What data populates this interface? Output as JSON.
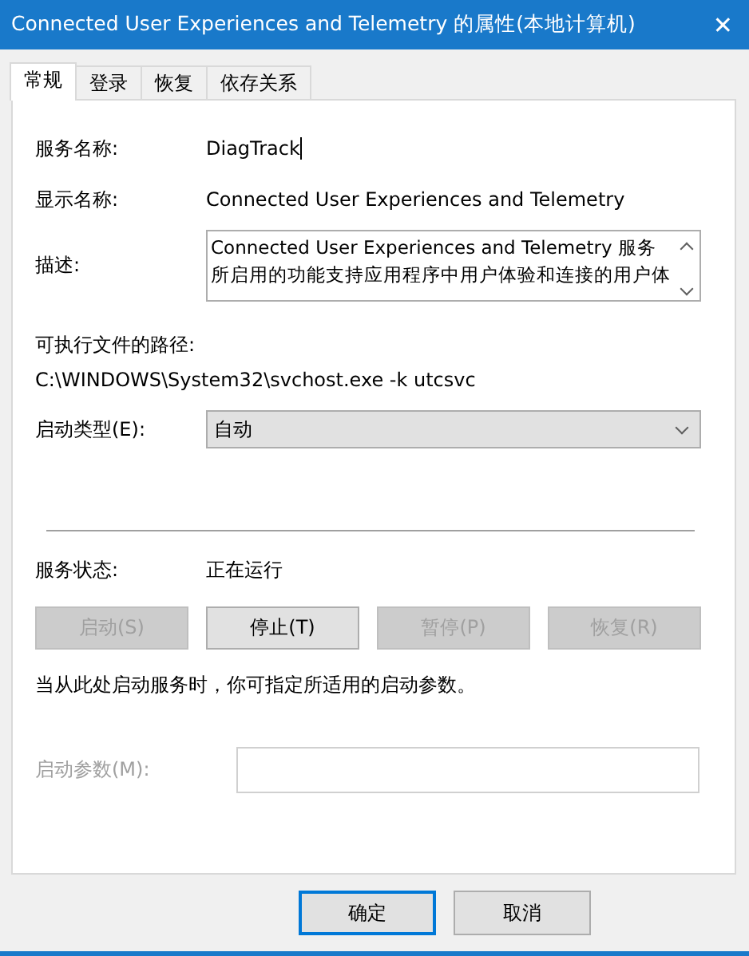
{
  "window": {
    "title": "Connected User Experiences and Telemetry 的属性(本地计算机)",
    "close": "✕"
  },
  "tabs": [
    {
      "label": "常规",
      "selected": true
    },
    {
      "label": "登录",
      "selected": false
    },
    {
      "label": "恢复",
      "selected": false
    },
    {
      "label": "依存关系",
      "selected": false
    }
  ],
  "service_name": {
    "label": "服务名称:",
    "value": "DiagTrack"
  },
  "display_name": {
    "label": "显示名称:",
    "value": "Connected User Experiences and Telemetry"
  },
  "description": {
    "label": "描述:",
    "value": "Connected User Experiences and Telemetry 服务所启用的功能支持应用程序中用户体验和连接的用户体"
  },
  "path": {
    "label": "可执行文件的路径:",
    "value": "C:\\WINDOWS\\System32\\svchost.exe -k utcsvc"
  },
  "startup_type": {
    "label": "启动类型(E):",
    "value": "自动"
  },
  "service_status": {
    "label": "服务状态:",
    "value": "正在运行"
  },
  "service_buttons": [
    {
      "label": "启动(S)",
      "disabled": true
    },
    {
      "label": "停止(T)",
      "disabled": false
    },
    {
      "label": "暂停(P)",
      "disabled": true
    },
    {
      "label": "恢复(R)",
      "disabled": true
    }
  ],
  "note": "当从此处启动服务时，你可指定所适用的启动参数。",
  "start_parameters": {
    "label": "启动参数(M):",
    "disabled": true
  },
  "buttons": [
    {
      "label": "确定",
      "default": true
    },
    {
      "label": "取消",
      "default": false
    }
  ]
}
